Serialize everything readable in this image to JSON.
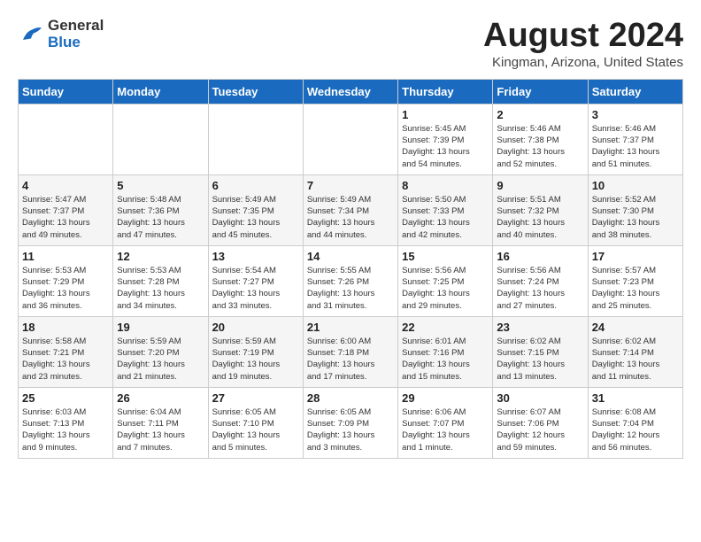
{
  "header": {
    "logo_line1": "General",
    "logo_line2": "Blue",
    "month": "August 2024",
    "location": "Kingman, Arizona, United States"
  },
  "weekdays": [
    "Sunday",
    "Monday",
    "Tuesday",
    "Wednesday",
    "Thursday",
    "Friday",
    "Saturday"
  ],
  "weeks": [
    [
      {
        "day": "",
        "info": ""
      },
      {
        "day": "",
        "info": ""
      },
      {
        "day": "",
        "info": ""
      },
      {
        "day": "",
        "info": ""
      },
      {
        "day": "1",
        "info": "Sunrise: 5:45 AM\nSunset: 7:39 PM\nDaylight: 13 hours\nand 54 minutes."
      },
      {
        "day": "2",
        "info": "Sunrise: 5:46 AM\nSunset: 7:38 PM\nDaylight: 13 hours\nand 52 minutes."
      },
      {
        "day": "3",
        "info": "Sunrise: 5:46 AM\nSunset: 7:37 PM\nDaylight: 13 hours\nand 51 minutes."
      }
    ],
    [
      {
        "day": "4",
        "info": "Sunrise: 5:47 AM\nSunset: 7:37 PM\nDaylight: 13 hours\nand 49 minutes."
      },
      {
        "day": "5",
        "info": "Sunrise: 5:48 AM\nSunset: 7:36 PM\nDaylight: 13 hours\nand 47 minutes."
      },
      {
        "day": "6",
        "info": "Sunrise: 5:49 AM\nSunset: 7:35 PM\nDaylight: 13 hours\nand 45 minutes."
      },
      {
        "day": "7",
        "info": "Sunrise: 5:49 AM\nSunset: 7:34 PM\nDaylight: 13 hours\nand 44 minutes."
      },
      {
        "day": "8",
        "info": "Sunrise: 5:50 AM\nSunset: 7:33 PM\nDaylight: 13 hours\nand 42 minutes."
      },
      {
        "day": "9",
        "info": "Sunrise: 5:51 AM\nSunset: 7:32 PM\nDaylight: 13 hours\nand 40 minutes."
      },
      {
        "day": "10",
        "info": "Sunrise: 5:52 AM\nSunset: 7:30 PM\nDaylight: 13 hours\nand 38 minutes."
      }
    ],
    [
      {
        "day": "11",
        "info": "Sunrise: 5:53 AM\nSunset: 7:29 PM\nDaylight: 13 hours\nand 36 minutes."
      },
      {
        "day": "12",
        "info": "Sunrise: 5:53 AM\nSunset: 7:28 PM\nDaylight: 13 hours\nand 34 minutes."
      },
      {
        "day": "13",
        "info": "Sunrise: 5:54 AM\nSunset: 7:27 PM\nDaylight: 13 hours\nand 33 minutes."
      },
      {
        "day": "14",
        "info": "Sunrise: 5:55 AM\nSunset: 7:26 PM\nDaylight: 13 hours\nand 31 minutes."
      },
      {
        "day": "15",
        "info": "Sunrise: 5:56 AM\nSunset: 7:25 PM\nDaylight: 13 hours\nand 29 minutes."
      },
      {
        "day": "16",
        "info": "Sunrise: 5:56 AM\nSunset: 7:24 PM\nDaylight: 13 hours\nand 27 minutes."
      },
      {
        "day": "17",
        "info": "Sunrise: 5:57 AM\nSunset: 7:23 PM\nDaylight: 13 hours\nand 25 minutes."
      }
    ],
    [
      {
        "day": "18",
        "info": "Sunrise: 5:58 AM\nSunset: 7:21 PM\nDaylight: 13 hours\nand 23 minutes."
      },
      {
        "day": "19",
        "info": "Sunrise: 5:59 AM\nSunset: 7:20 PM\nDaylight: 13 hours\nand 21 minutes."
      },
      {
        "day": "20",
        "info": "Sunrise: 5:59 AM\nSunset: 7:19 PM\nDaylight: 13 hours\nand 19 minutes."
      },
      {
        "day": "21",
        "info": "Sunrise: 6:00 AM\nSunset: 7:18 PM\nDaylight: 13 hours\nand 17 minutes."
      },
      {
        "day": "22",
        "info": "Sunrise: 6:01 AM\nSunset: 7:16 PM\nDaylight: 13 hours\nand 15 minutes."
      },
      {
        "day": "23",
        "info": "Sunrise: 6:02 AM\nSunset: 7:15 PM\nDaylight: 13 hours\nand 13 minutes."
      },
      {
        "day": "24",
        "info": "Sunrise: 6:02 AM\nSunset: 7:14 PM\nDaylight: 13 hours\nand 11 minutes."
      }
    ],
    [
      {
        "day": "25",
        "info": "Sunrise: 6:03 AM\nSunset: 7:13 PM\nDaylight: 13 hours\nand 9 minutes."
      },
      {
        "day": "26",
        "info": "Sunrise: 6:04 AM\nSunset: 7:11 PM\nDaylight: 13 hours\nand 7 minutes."
      },
      {
        "day": "27",
        "info": "Sunrise: 6:05 AM\nSunset: 7:10 PM\nDaylight: 13 hours\nand 5 minutes."
      },
      {
        "day": "28",
        "info": "Sunrise: 6:05 AM\nSunset: 7:09 PM\nDaylight: 13 hours\nand 3 minutes."
      },
      {
        "day": "29",
        "info": "Sunrise: 6:06 AM\nSunset: 7:07 PM\nDaylight: 13 hours\nand 1 minute."
      },
      {
        "day": "30",
        "info": "Sunrise: 6:07 AM\nSunset: 7:06 PM\nDaylight: 12 hours\nand 59 minutes."
      },
      {
        "day": "31",
        "info": "Sunrise: 6:08 AM\nSunset: 7:04 PM\nDaylight: 12 hours\nand 56 minutes."
      }
    ]
  ]
}
